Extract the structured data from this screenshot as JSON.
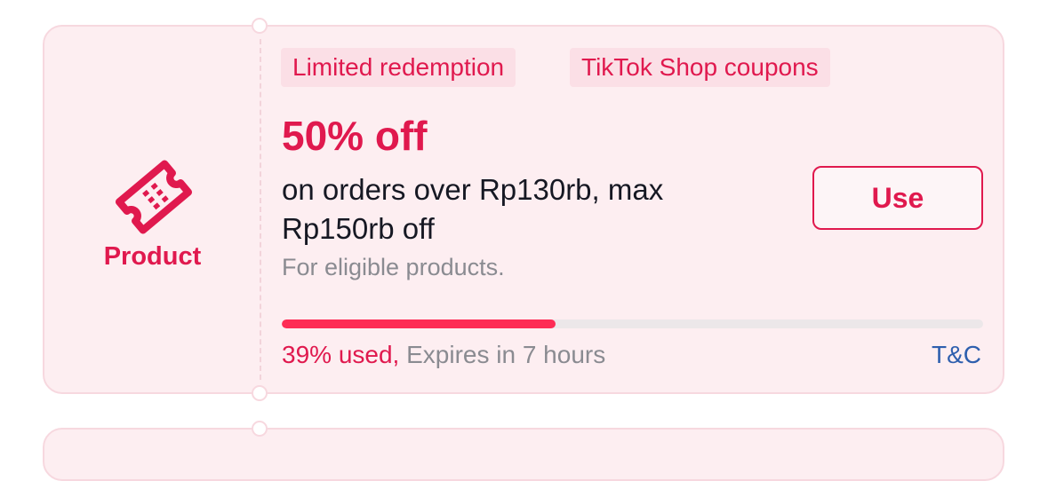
{
  "coupon": {
    "type_label": "Product",
    "type_icon": "ticket-icon",
    "tags": [
      "Limited redemption",
      "TikTok Shop coupons"
    ],
    "discount": "50% off",
    "condition": "on orders over Rp130rb, max Rp150rb off",
    "eligibility": "For eligible products.",
    "use_button_label": "Use",
    "usage_fraction": 0.39,
    "used_text": "39% used,",
    "expiry_text": "Expires in 7 hours",
    "terms_link": "T&C"
  },
  "colors": {
    "accent": "#e0194e",
    "progress": "#fe2c55",
    "card_background": "#fdeef1",
    "link": "#2e5fae"
  }
}
